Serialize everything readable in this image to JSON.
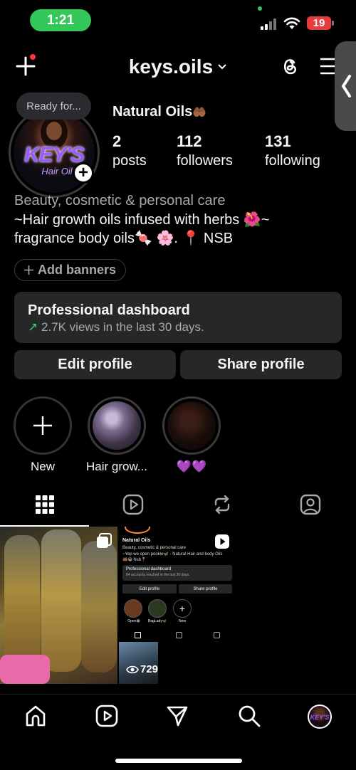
{
  "status_bar": {
    "time": "1:21",
    "battery": "19"
  },
  "header": {
    "username": "keys.oils"
  },
  "profile": {
    "note": "Ready for...",
    "logo_text": "KEY'S",
    "logo_sub": "Hair Oil",
    "display_name": "Natural Oils",
    "display_name_emoji": "🤲🏾",
    "stats": [
      {
        "value": "2",
        "label": "posts"
      },
      {
        "value": "112",
        "label": "followers"
      },
      {
        "value": "131",
        "label": "following"
      }
    ],
    "category": "Beauty, cosmetic & personal care",
    "bio_line1": "~Hair growth oils infused with herbs 🌺~",
    "bio_line2": "fragrance body oils🍬 🌸. 📍 NSB"
  },
  "add_banners_label": "Add banners",
  "dashboard": {
    "title": "Professional dashboard",
    "arrow": "↗",
    "subtitle": "2.7K views in the last 30 days."
  },
  "buttons": {
    "edit_profile": "Edit profile",
    "share_profile": "Share profile"
  },
  "highlights": [
    {
      "label": "New"
    },
    {
      "label": "Hair grow..."
    },
    {
      "label": "💜💜"
    }
  ],
  "tabs": [
    "grid-icon",
    "reels-icon",
    "reposts-icon",
    "tagged-icon"
  ],
  "posts": [
    {
      "type": "photo"
    },
    {
      "type": "reel-screenshot",
      "screenshot": {
        "name": "Natural Oils",
        "category": "Beauty, cosmetic & personal care",
        "bio": "~Yep we open pookie🦋 - Natural Hair and body Oils",
        "bio2": "🤲🏾😁 Nsb📍",
        "dash_title": "Professional dashboard",
        "dash_sub": "84 accounts reached in the last 30 days.",
        "edit": "Edit profile",
        "share": "Share profile",
        "hl1": "Open😁",
        "hl2": "BagLady🦋",
        "hl3": "New"
      },
      "views": "729"
    }
  ],
  "colors": {
    "status_green": "#34c759",
    "battery_red": "#e83b3b",
    "notif_red": "#ff3040",
    "button_bg": "#262728",
    "accent_purple": "#9b59ff",
    "growth_green": "#3ccf6f"
  }
}
